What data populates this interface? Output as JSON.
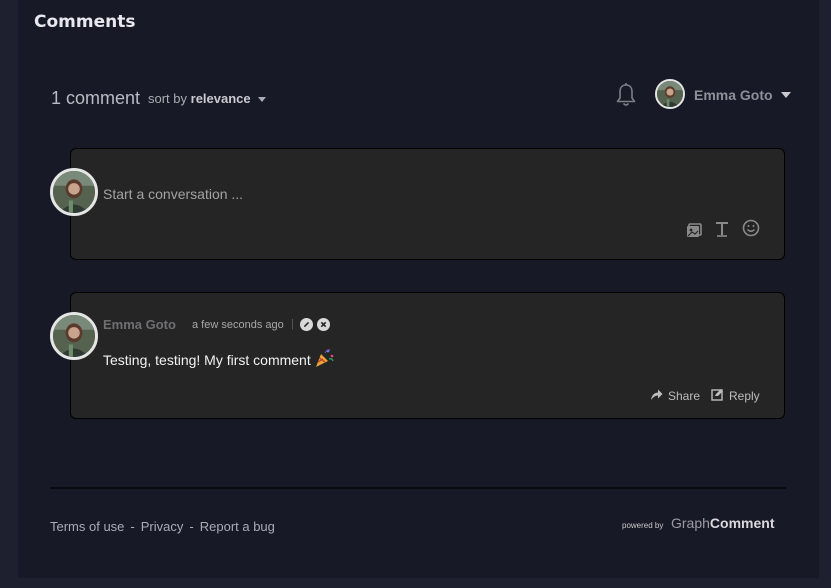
{
  "section_title": "Comments",
  "header": {
    "count_label": "1 comment",
    "sort_prefix": "sort by",
    "sort_value": "relevance",
    "user_name": "Emma Goto"
  },
  "composer": {
    "placeholder": "Start a conversation ..."
  },
  "comments": [
    {
      "author": "Emma Goto",
      "time": "a few seconds ago",
      "separator": "|",
      "text": "Testing, testing! My first comment",
      "share_label": "Share",
      "reply_label": "Reply"
    }
  ],
  "footer": {
    "terms": "Terms of use",
    "privacy": "Privacy",
    "report": "Report a bug",
    "dash": "-",
    "powered_by": "powered by",
    "brand_light": "Graph",
    "brand_bold": "Comment"
  },
  "icons": {
    "bell": "bell-icon",
    "image": "image-icon",
    "text_format": "text-format-icon",
    "emoji": "smiley-icon",
    "edit": "edit-icon",
    "delete": "delete-icon",
    "share": "share-arrow-icon",
    "reply": "reply-icon",
    "party": "party-popper-icon"
  },
  "colors": {
    "background": "#1e2030",
    "panel": "#171a26",
    "card": "#252525"
  }
}
